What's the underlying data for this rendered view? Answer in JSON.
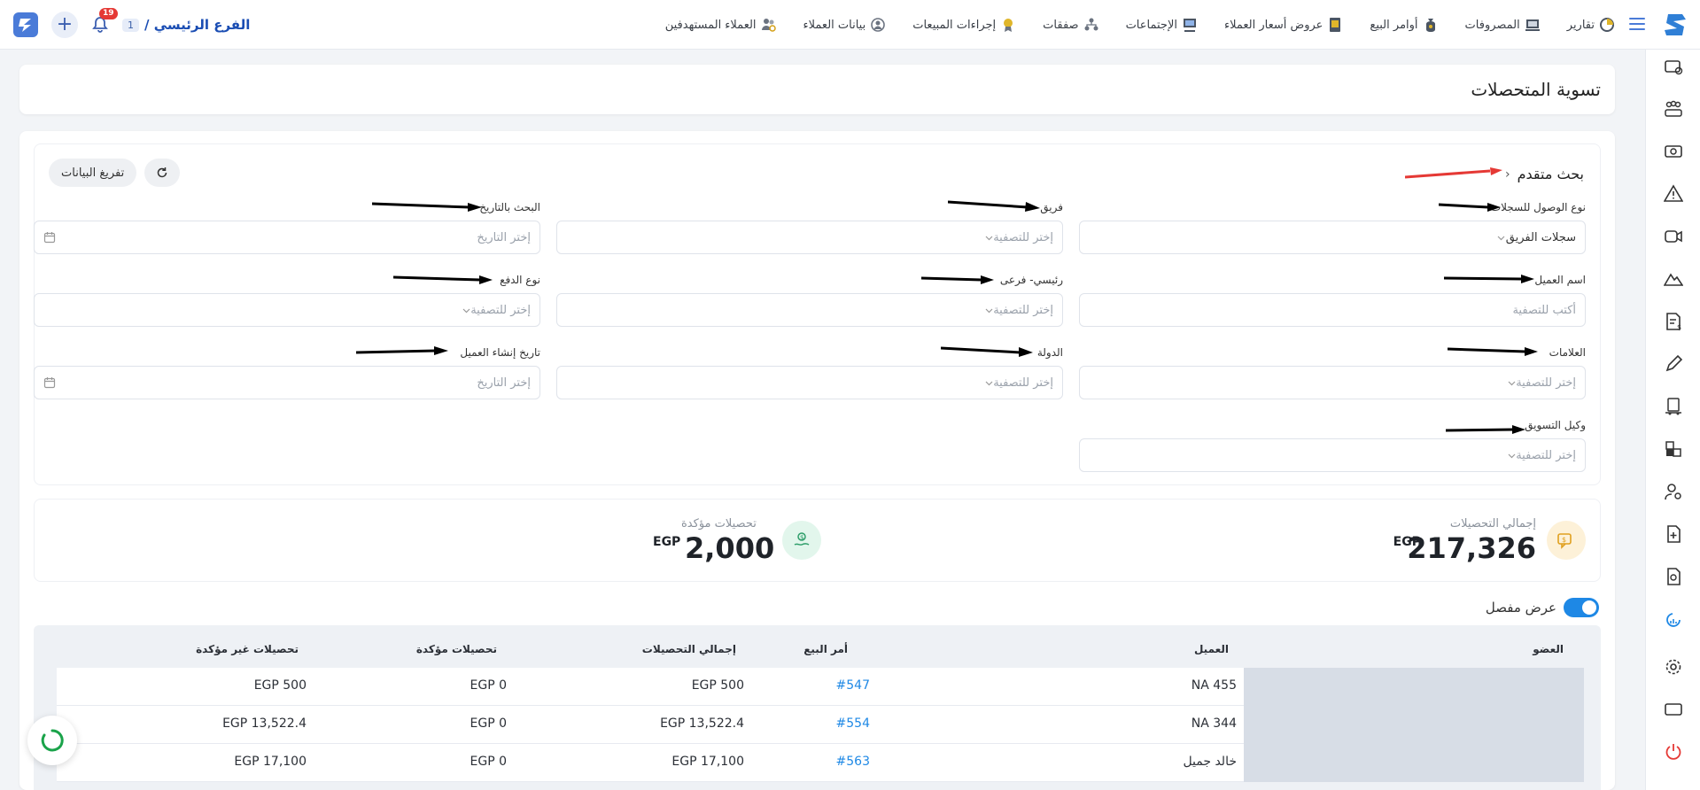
{
  "header": {
    "branch_num": "1",
    "branch_name": "الفرع الرئيسي /",
    "notification_count": "19",
    "nav": [
      {
        "label": "العملاء المستهدفين",
        "icon": "users-target-icon"
      },
      {
        "label": "بيانات العملاء",
        "icon": "customer-data-icon"
      },
      {
        "label": "إجراءات المبيعات",
        "icon": "award-icon"
      },
      {
        "label": "صفقات",
        "icon": "deals-icon"
      },
      {
        "label": "الإجتماعات",
        "icon": "meetings-icon"
      },
      {
        "label": "عروض أسعار العملاء",
        "icon": "quotes-icon"
      },
      {
        "label": "أوامر البيع",
        "icon": "sales-orders-icon"
      },
      {
        "label": "المصروفات",
        "icon": "expenses-icon"
      },
      {
        "label": "تقارير",
        "icon": "reports-icon"
      }
    ]
  },
  "page": {
    "title": "تسوية المتحصلات"
  },
  "filters": {
    "advanced_search": "بحث متقدم",
    "clear_button": "تفريغ البيانات",
    "access_type": {
      "label": "نوع الوصول للسجلات",
      "value": "سجلات الفريق"
    },
    "team": {
      "label": "فريق",
      "placeholder": "إختر للتصفية"
    },
    "date_search": {
      "label": "البحث بالتاريخ",
      "placeholder": "إختر التاريخ"
    },
    "customer_name": {
      "label": "اسم العميل",
      "placeholder": "أكتب للتصفية"
    },
    "main_sub": {
      "label": "رئيسي- فرعى",
      "placeholder": "إختر للتصفية"
    },
    "payment_type": {
      "label": "نوع الدفع",
      "placeholder": "إختر للتصفية"
    },
    "tags": {
      "label": "العلامات",
      "placeholder": "إختر للتصفية"
    },
    "country": {
      "label": "الدولة",
      "placeholder": "إختر للتصفية"
    },
    "customer_created": {
      "label": "تاريخ إنشاء العميل",
      "placeholder": "إختر التاريخ"
    },
    "marketing_agent": {
      "label": "وكيل التسويق",
      "placeholder": "إختر للتصفية"
    }
  },
  "stats": {
    "total": {
      "label": "إجمالي التحصيلات",
      "value": "217,326",
      "currency": "EGP"
    },
    "confirmed": {
      "label": "تحصيلات مؤكدة",
      "value": "2,000",
      "currency": "EGP"
    }
  },
  "toggle": {
    "label": "عرض مفصل",
    "on": true
  },
  "table": {
    "headers": {
      "member": "العضو",
      "customer": "العميل",
      "sales_order": "أمر البيع",
      "total": "إجمالي التحصيلات",
      "confirmed": "تحصيلات مؤكدة",
      "unconfirmed": "تحصيلات غير مؤكدة"
    },
    "rows": [
      {
        "customer": "NA 455",
        "order": "#547",
        "total": "EGP 500",
        "confirmed": "EGP 0",
        "unconfirmed": "EGP 500"
      },
      {
        "customer": "NA 344",
        "order": "#554",
        "total": "EGP 13,522.4",
        "confirmed": "EGP 0",
        "unconfirmed": "EGP 13,522.4"
      },
      {
        "customer": "خالد جميل",
        "order": "#563",
        "total": "EGP 17,100",
        "confirmed": "EGP 0",
        "unconfirmed": "EGP 17,100"
      }
    ]
  },
  "colors": {
    "brand": "#1e88e5",
    "annotation_red": "#e53935",
    "annotation_black": "#000000"
  }
}
